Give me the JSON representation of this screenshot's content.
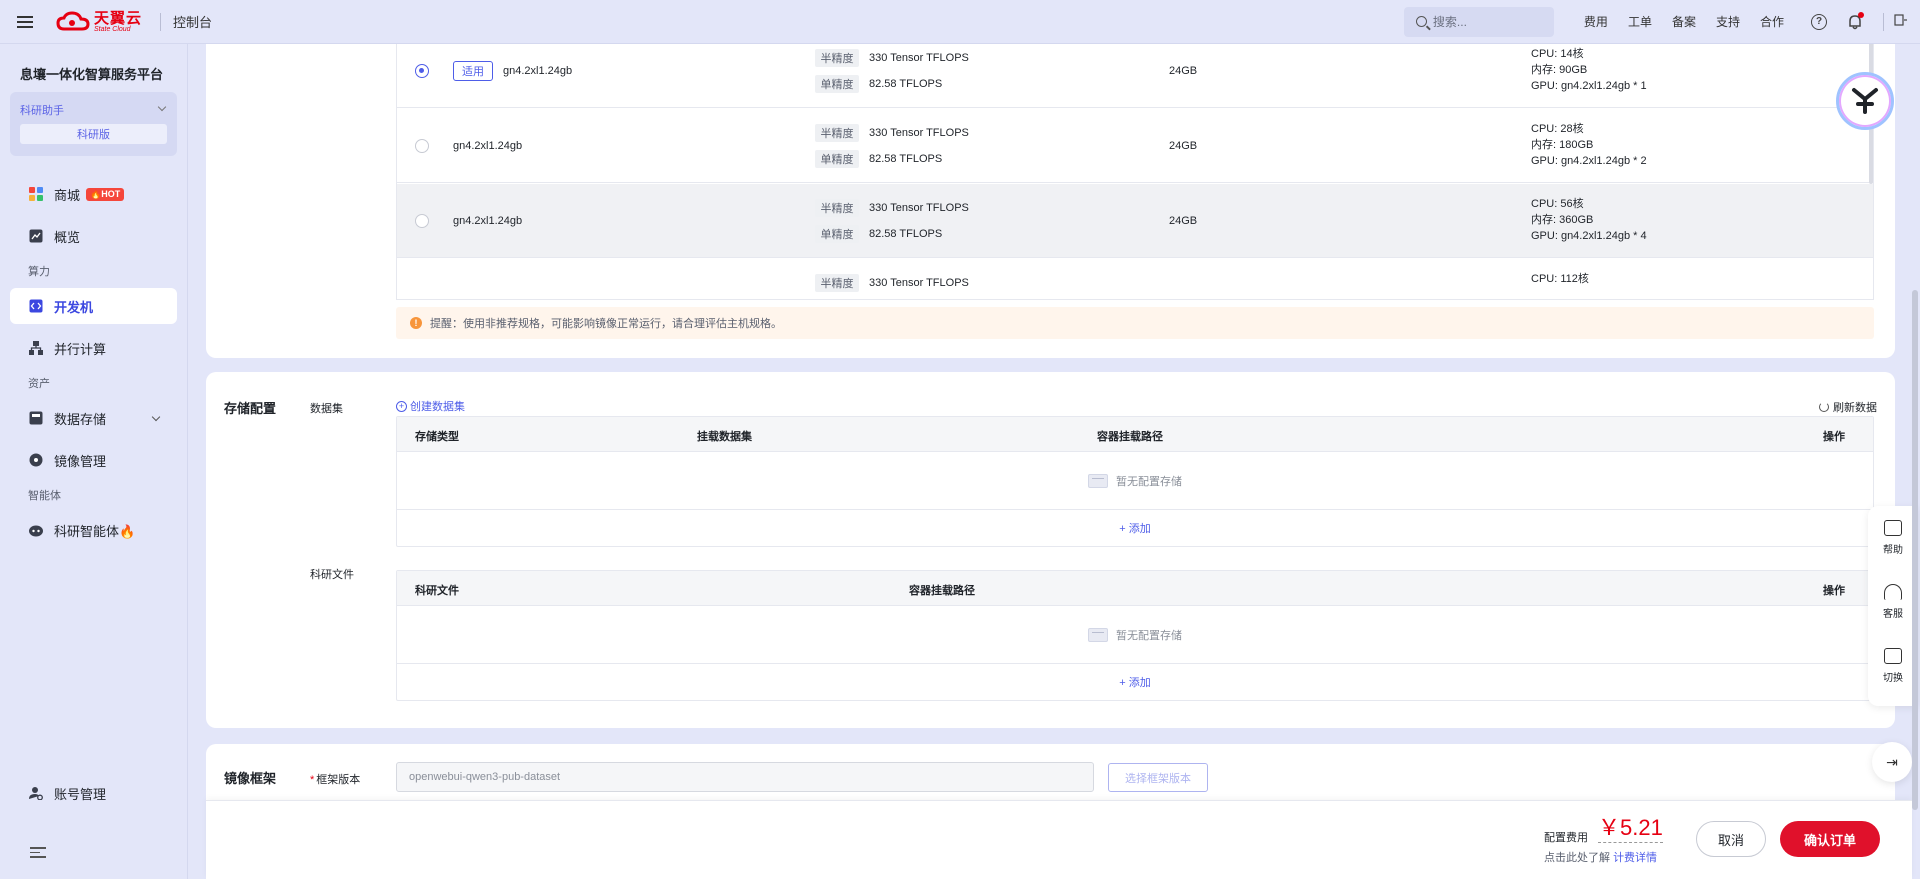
{
  "topbar": {
    "logo_cn": "天翼云",
    "logo_en": "State Cloud",
    "console": "控制台",
    "search_placeholder": "搜索...",
    "links": [
      "费用",
      "工单",
      "备案",
      "支持",
      "合作"
    ]
  },
  "sidebar": {
    "platform": "息壤一体化智算服务平台",
    "assistant_label": "科研助手",
    "assistant_edition": "科研版",
    "items": {
      "mall": "商城",
      "hot": "🔥HOT",
      "overview": "概览",
      "group_compute": "算力",
      "devbox": "开发机",
      "parallel": "并行计算",
      "group_assets": "资产",
      "storage": "数据存储",
      "image": "镜像管理",
      "group_agent": "智能体",
      "agent": "科研智能体🔥",
      "account": "账号管理"
    }
  },
  "spec_table": {
    "apply_tag": "适用",
    "rows": [
      {
        "name": "gn4.2xl1.24gb",
        "half_label": "半精度",
        "half": "330 Tensor TFLOPS",
        "single_label": "单精度",
        "single": "82.58 TFLOPS",
        "mem": "24GB",
        "cpu": "CPU: 14核",
        "ram": "内存: 90GB",
        "gpu": "GPU: gn4.2xl1.24gb * 1",
        "checked": true
      },
      {
        "name": "gn4.2xl1.24gb",
        "half_label": "半精度",
        "half": "330 Tensor TFLOPS",
        "single_label": "单精度",
        "single": "82.58 TFLOPS",
        "mem": "24GB",
        "cpu": "CPU: 28核",
        "ram": "内存: 180GB",
        "gpu": "GPU: gn4.2xl1.24gb * 2",
        "checked": false
      },
      {
        "name": "gn4.2xl1.24gb",
        "half_label": "半精度",
        "half": "330 Tensor TFLOPS",
        "single_label": "单精度",
        "single": "82.58 TFLOPS",
        "mem": "24GB",
        "cpu": "CPU: 56核",
        "ram": "内存: 360GB",
        "gpu": "GPU: gn4.2xl1.24gb * 4",
        "checked": false
      },
      {
        "half_label": "半精度",
        "half": "330 Tensor TFLOPS",
        "cpu": "CPU: 112核"
      }
    ],
    "warning": "提醒：使用非推荐规格，可能影响镜像正常运行，请合理评估主机规格。"
  },
  "storage": {
    "title": "存储配置",
    "dataset_label": "数据集",
    "create_dataset": "创建数据集",
    "refresh": "刷新数据",
    "dataset_headers": [
      "存储类型",
      "挂载数据集",
      "容器挂载路径",
      "操作"
    ],
    "empty": "暂无配置存储",
    "add": "+ 添加",
    "files_label": "科研文件",
    "files_headers": [
      "科研文件",
      "容器挂载路径",
      "操作"
    ]
  },
  "image": {
    "title": "镜像框架",
    "req": "*",
    "version_label": "框架版本",
    "version_value": "openwebui-qwen3-pub-dataset",
    "select_btn": "选择框架版本"
  },
  "footer": {
    "fee_label": "配置费用",
    "fee_value": "￥5.21",
    "hint": "点击此处了解",
    "hint_link": "计费详情",
    "cancel": "取消",
    "confirm": "确认订单"
  },
  "float_tools": [
    "帮助",
    "客服",
    "切换"
  ]
}
